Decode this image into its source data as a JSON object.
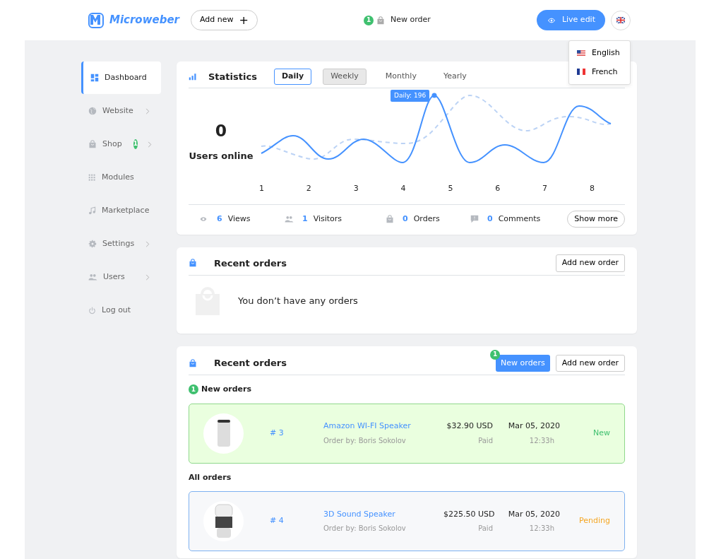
{
  "header": {
    "logo": "Microweber",
    "add_new": "Add new",
    "add_icon": "+",
    "notification": {
      "count": "1",
      "label": "New order"
    },
    "live_edit": "Live edit"
  },
  "language_menu": [
    {
      "label": "English"
    },
    {
      "label": "French"
    }
  ],
  "sidebar": {
    "items": [
      {
        "label": "Dashboard",
        "selected": true,
        "submenu": false
      },
      {
        "label": "Website",
        "selected": false,
        "submenu": true
      },
      {
        "label": "Shop",
        "selected": false,
        "submenu": true,
        "badge": "1"
      },
      {
        "label": "Modules",
        "selected": false,
        "submenu": false
      },
      {
        "label": "Marketplace",
        "selected": false,
        "submenu": false
      },
      {
        "label": "Settings",
        "selected": false,
        "submenu": true
      },
      {
        "label": "Users",
        "selected": false,
        "submenu": true
      },
      {
        "label": "Log out",
        "selected": false,
        "submenu": false
      }
    ]
  },
  "statistics": {
    "title": "Statistics",
    "tabs": [
      {
        "label": "Daily",
        "selected": true,
        "hovered": false
      },
      {
        "label": "Weekly",
        "selected": false,
        "hovered": true
      },
      {
        "label": "Monthly",
        "selected": false,
        "hovered": false
      },
      {
        "label": "Yearly",
        "selected": false,
        "hovered": false
      }
    ],
    "users_online": {
      "value": "0",
      "label": "Users online"
    },
    "chart": {
      "tooltip": "Daily: 196",
      "x_labels": [
        "1",
        "2",
        "3",
        "4",
        "5",
        "6",
        "7",
        "8"
      ]
    },
    "summary": [
      {
        "value": "6",
        "label": "Views"
      },
      {
        "value": "1",
        "label": "Visitors"
      },
      {
        "value": "0",
        "label": "Orders"
      },
      {
        "value": "0",
        "label": "Comments"
      }
    ],
    "show_more": "Show more"
  },
  "recent_orders_empty": {
    "title": "Recent orders",
    "add_button": "Add new order",
    "message": "You don’t have any orders"
  },
  "recent_orders": {
    "title": "Recent orders",
    "new_orders_button": {
      "label": "New orders",
      "badge": "1"
    },
    "add_button": "Add new order",
    "sections": [
      {
        "badge": "1",
        "title": "New orders",
        "orders": [
          {
            "number": "# 3",
            "product": "Amazon WI-FI Speaker",
            "customer": "Order by: Boris Sokolov",
            "price": "$32.90 USD",
            "payment": "Paid",
            "date": "Mar 05, 2020",
            "time": "12:33h",
            "status": "New",
            "color": "#3fc06f",
            "highlighted": true
          }
        ]
      },
      {
        "title": "All orders",
        "orders": [
          {
            "number": "# 4",
            "product": "3D Sound Speaker",
            "customer": "Order by: Boris Sokolov",
            "price": "$225.50 USD",
            "payment": "Paid",
            "date": "Mar 05, 2020",
            "time": "12:33h",
            "status": "Pending",
            "color": "#f5a623",
            "highlighted": false
          }
        ]
      }
    ]
  }
}
